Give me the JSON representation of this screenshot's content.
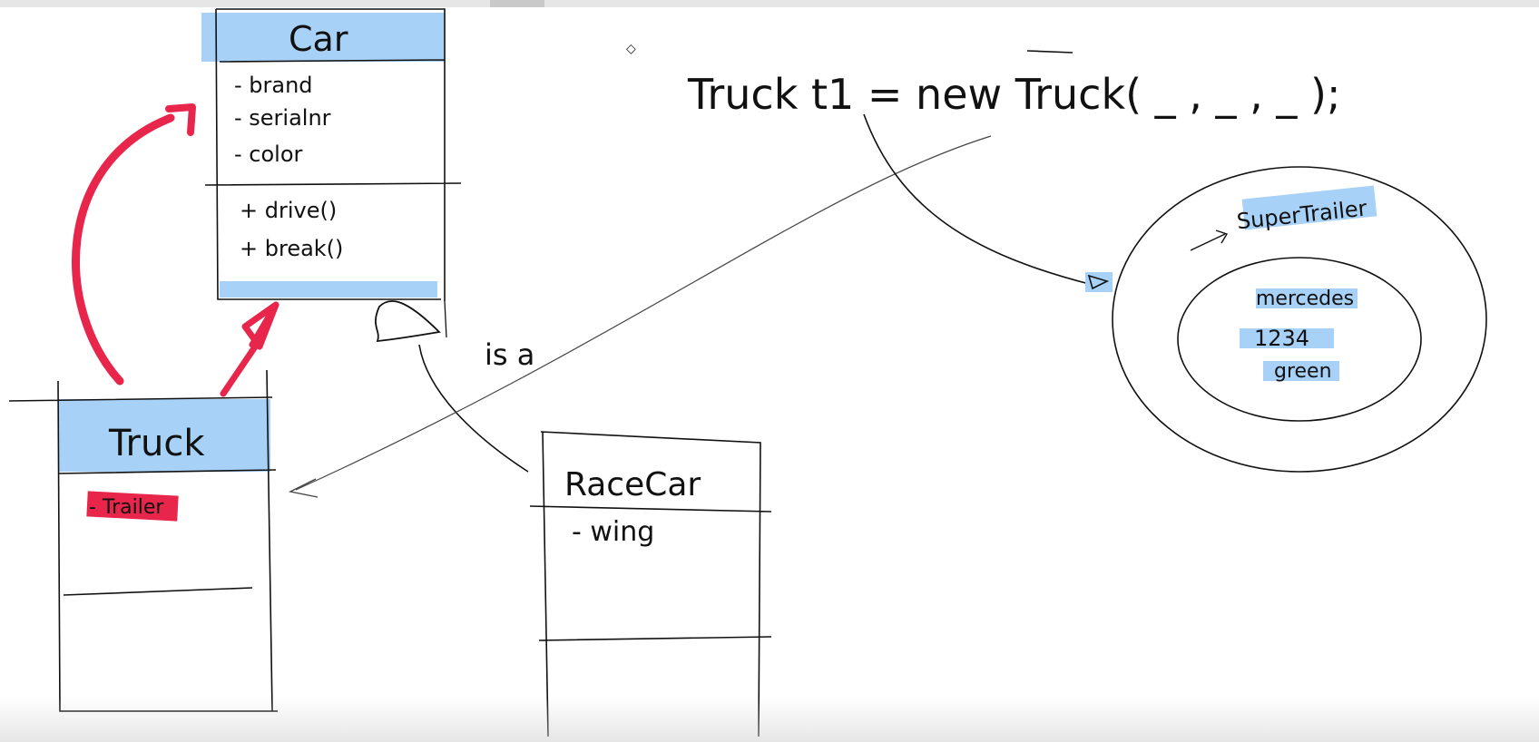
{
  "classes": {
    "car": {
      "name": "Car",
      "attributes": [
        "- brand",
        "- serialnr",
        "- color"
      ],
      "methods": [
        "+ drive()",
        "+ break()"
      ]
    },
    "truck": {
      "name": "Truck",
      "attributes": [
        "- Trailer"
      ]
    },
    "racecar": {
      "name": "RaceCar",
      "attributes": [
        "- wing"
      ]
    }
  },
  "labels": {
    "is_a": "is a",
    "code": "Truck t1 = new Truck( _ , _ , _ );"
  },
  "object": {
    "outer_field": "SuperTrailer",
    "inner_values": [
      "mercedes",
      "1234",
      "green"
    ]
  },
  "colors": {
    "ink": "#111111",
    "highlight_blue": "#a8d1f7",
    "highlight_red": "#e8254b"
  }
}
